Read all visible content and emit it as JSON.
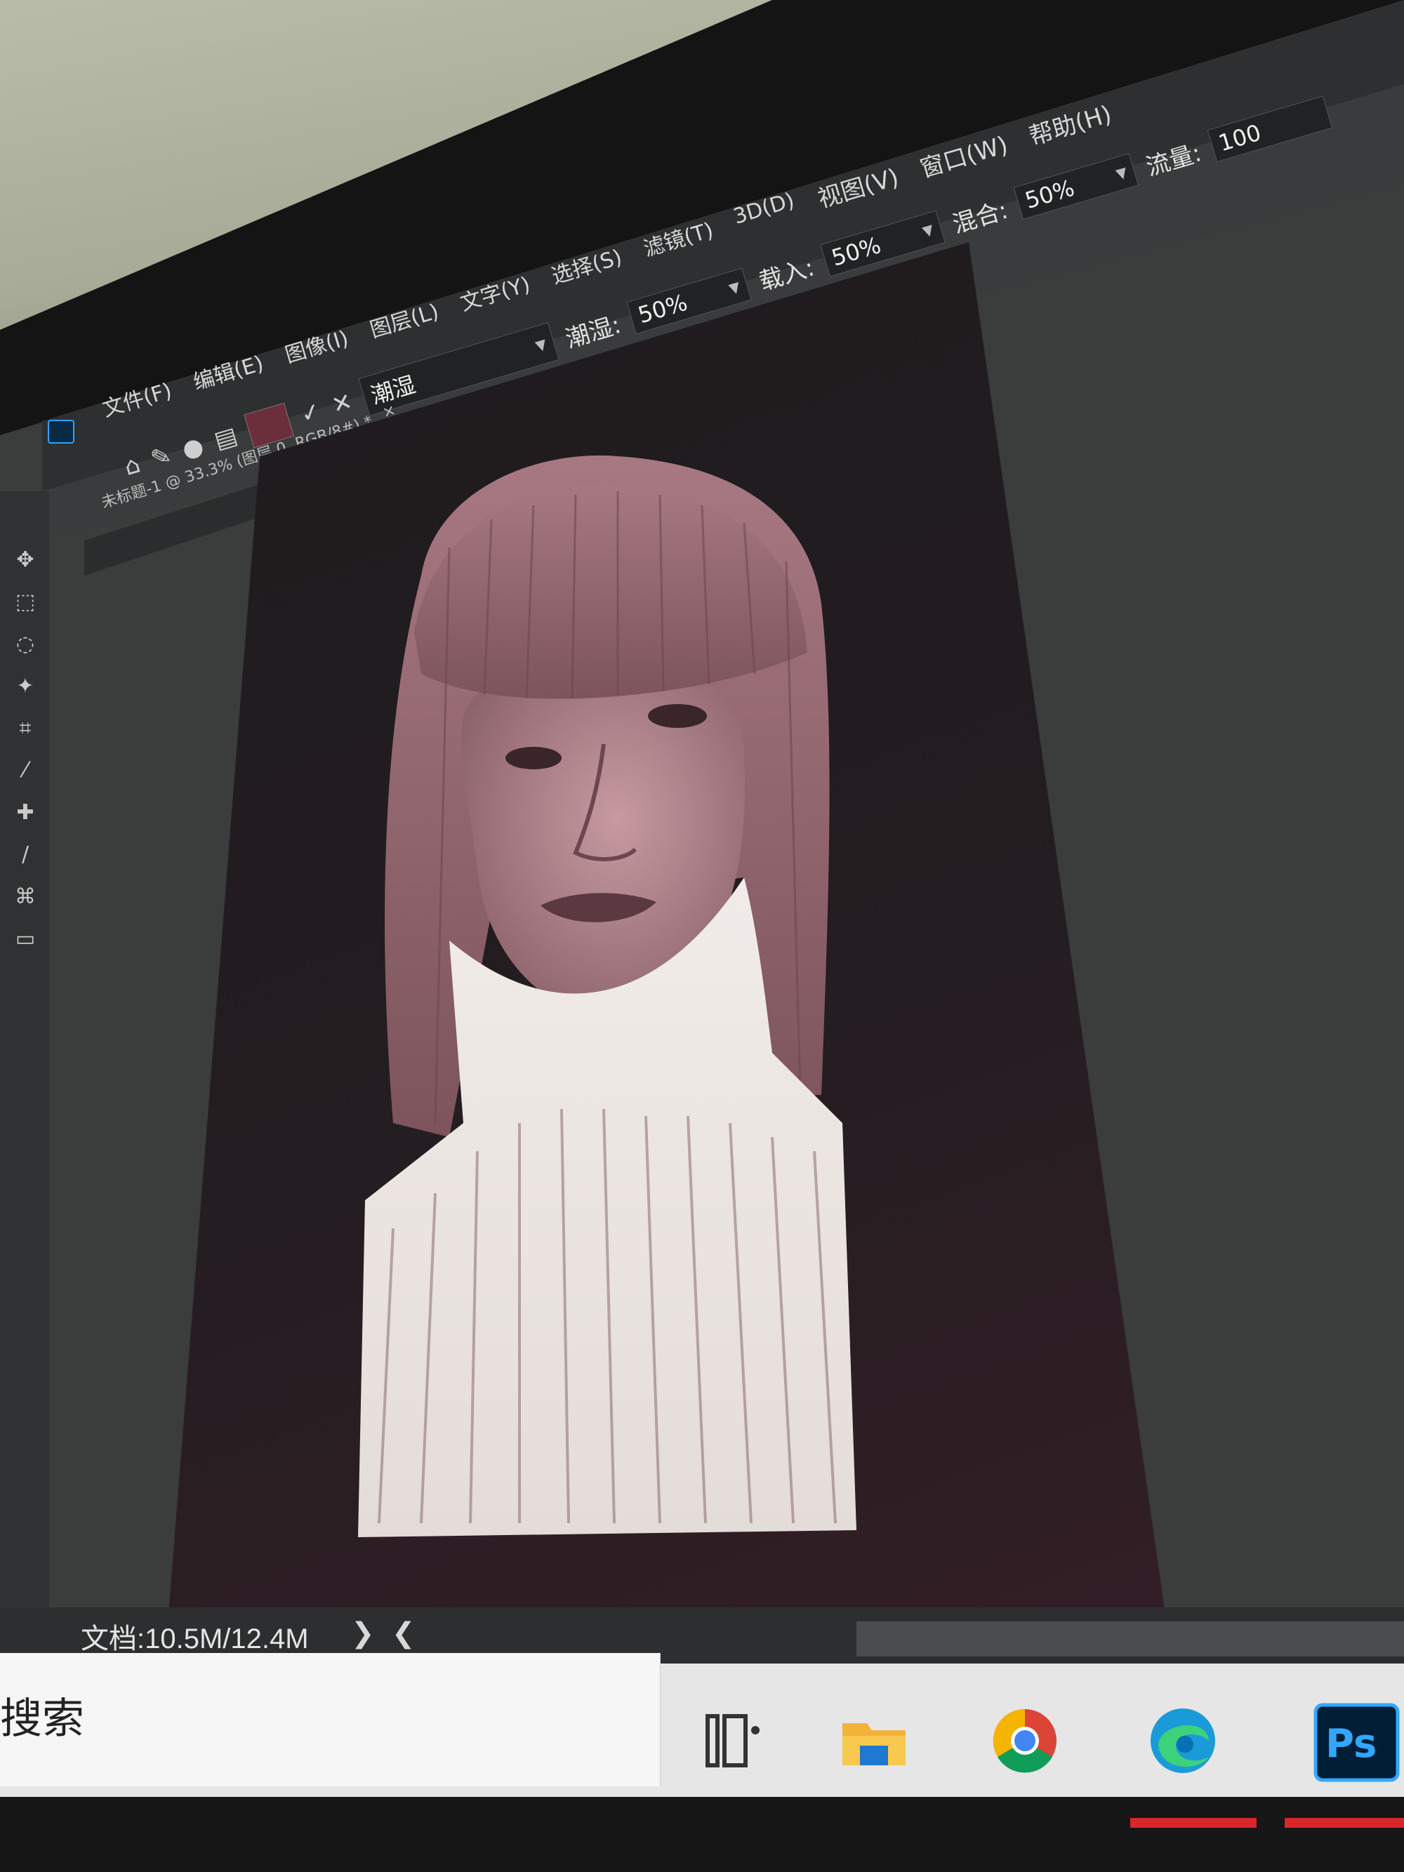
{
  "menu": {
    "items": [
      "文件(F)",
      "编辑(E)",
      "图像(I)",
      "图层(L)",
      "文字(Y)",
      "选择(S)",
      "滤镜(T)",
      "3D(D)",
      "视图(V)",
      "窗口(W)",
      "帮助(H)"
    ]
  },
  "options_bar": {
    "smudge_label": "潮湿:",
    "smudge_value": "50%",
    "load_label": "载入:",
    "load_value": "50%",
    "mix_label": "混合:",
    "mix_value": "50%",
    "flow_label": "流量:",
    "flow_value": "100",
    "preset_label": "潮湿",
    "swatch_color": "#6b2f3b"
  },
  "document_tab": {
    "title": "未标题-1 @ 33.3% (图层 0, RGB/8#) *",
    "close_icon": "close-icon"
  },
  "status": {
    "doc_info": "文档:10.5M/12.4M",
    "next_arrow": "❯",
    "prev_arrow": "❮"
  },
  "taskbar": {
    "search_label": "搜索",
    "apps": [
      "task-view-icon",
      "file-explorer-icon",
      "chrome-icon",
      "edge-icon",
      "photoshop-icon"
    ]
  },
  "colors": {
    "accent": "#2fa3ff",
    "canvas_bg": "#241d21",
    "hair": "#9a6d76",
    "skin": "#b98a92",
    "collar": "#efe9e6"
  }
}
